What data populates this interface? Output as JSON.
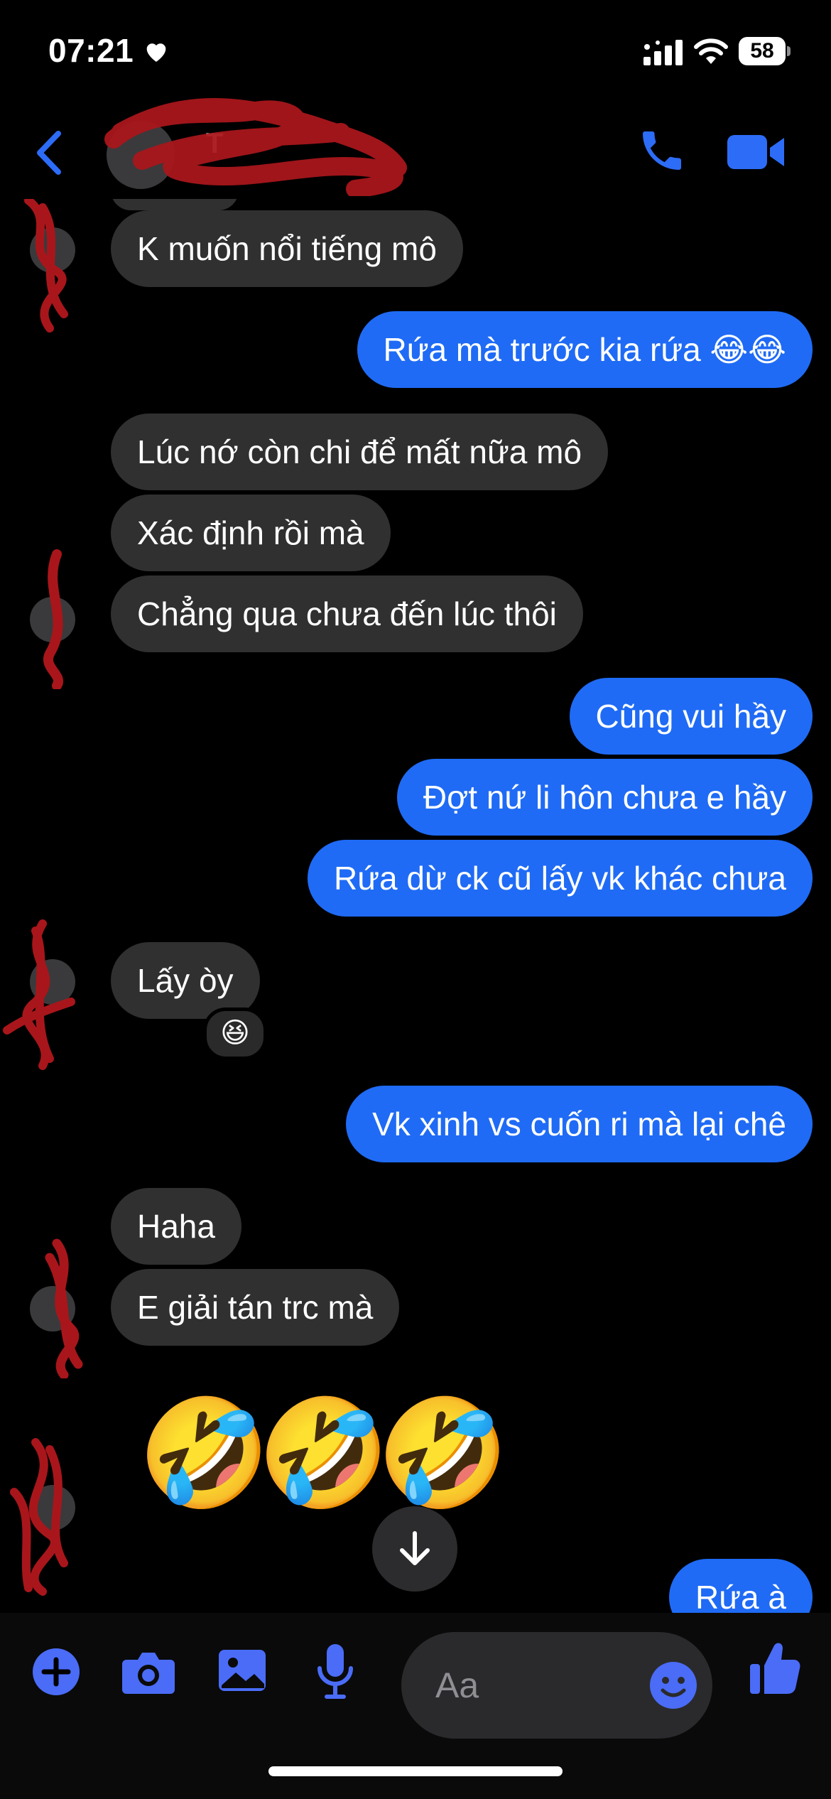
{
  "status_bar": {
    "time": "07:21",
    "battery": "58"
  },
  "header": {
    "contact_name": "T"
  },
  "messages": [
    {
      "id": "m1",
      "side": "in",
      "text": "K muốn nổi tiếng mô"
    },
    {
      "id": "m2",
      "side": "out",
      "text": "Rứa mà trước kia rứa 😂😂"
    },
    {
      "id": "m3",
      "side": "in",
      "text": "Lúc nớ còn chi để mất nữa mô"
    },
    {
      "id": "m4",
      "side": "in",
      "text": "Xác định rồi mà"
    },
    {
      "id": "m5",
      "side": "in",
      "text": "Chẳng qua chưa đến lúc thôi"
    },
    {
      "id": "m6",
      "side": "out",
      "text": "Cũng vui hầy"
    },
    {
      "id": "m7",
      "side": "out",
      "text": "Đợt nứ li hôn chưa e hầy"
    },
    {
      "id": "m8",
      "side": "out",
      "text": "Rứa dừ ck cũ lấy vk khác chưa"
    },
    {
      "id": "m9",
      "side": "in",
      "text": "Lấy òy",
      "reaction": "😆"
    },
    {
      "id": "m10",
      "side": "out",
      "text": "Vk xinh vs cuốn ri mà lại chê"
    },
    {
      "id": "m11",
      "side": "in",
      "text": "Haha"
    },
    {
      "id": "m12",
      "side": "in",
      "text": "E giải tán trc mà"
    },
    {
      "id": "m13",
      "side": "in",
      "emoji": [
        "🤣",
        "🤣",
        "🤣"
      ]
    },
    {
      "id": "m14",
      "side": "out",
      "text": "Rứa à"
    }
  ],
  "composer": {
    "placeholder": "Aa"
  },
  "icons": {
    "back": "chevron-left-icon",
    "call": "phone-icon",
    "video": "video-camera-icon",
    "add": "plus-circle-icon",
    "camera": "camera-icon",
    "gallery": "photo-icon",
    "mic": "microphone-icon",
    "emoji": "smiley-icon",
    "like": "thumbs-up-icon",
    "scroll_down": "arrow-down-icon",
    "heart": "heart-icon",
    "signal": "signal-icon",
    "wifi": "wifi-icon"
  },
  "colors": {
    "accent": "#1f6bf5",
    "icon_blue": "#4a6cf7",
    "incoming_bubble": "#303030",
    "background": "#000000"
  }
}
